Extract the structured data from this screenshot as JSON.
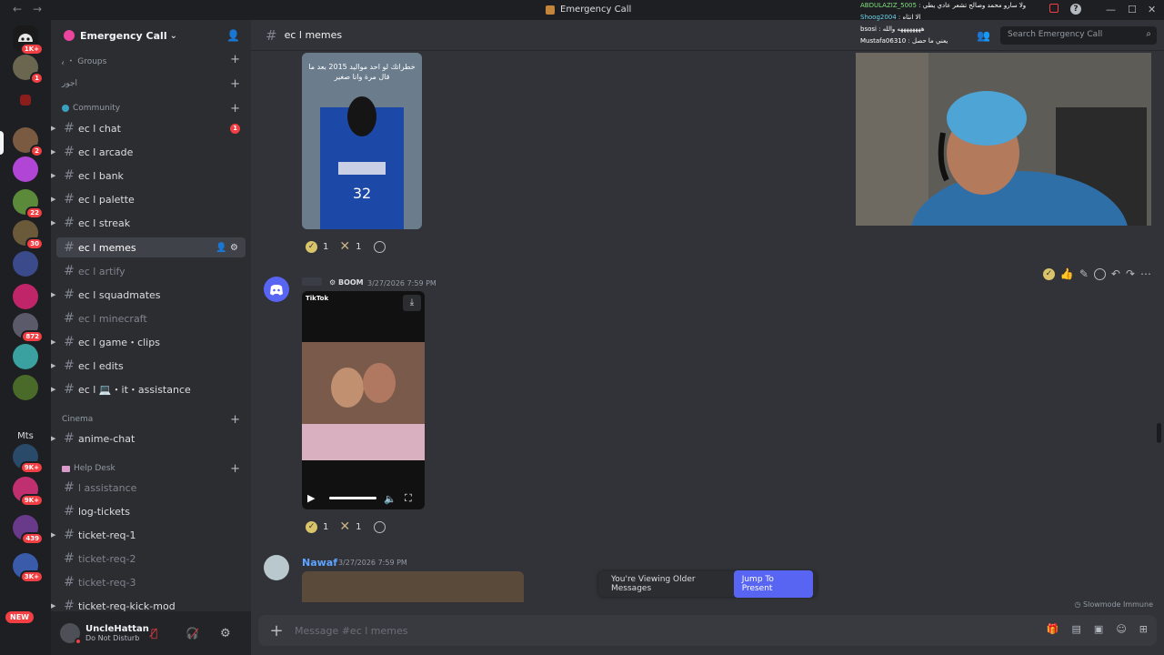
{
  "window": {
    "title": "Emergency Call",
    "back": "←",
    "forward": "→"
  },
  "guilds": {
    "badges": [
      "1K+",
      "1",
      "2",
      "22",
      "30",
      "872",
      "9K+",
      "9K+",
      "439",
      "3K+",
      "1K+"
    ],
    "mts": "Mts",
    "new": "NEW"
  },
  "server": {
    "name": "Emergency Call",
    "chevron": "⌄"
  },
  "categories": {
    "groups": "ﯾ ・ Groups",
    "ajoor": "اجور",
    "community": "Community",
    "cinema": "Cinema",
    "helpdesk": "Help Desk"
  },
  "channels": [
    {
      "name": "ec ⅼ chat",
      "badge": "1"
    },
    {
      "name": "ec ⅼ arcade"
    },
    {
      "name": "ec ⅼ bank"
    },
    {
      "name": "ec ⅼ palette"
    },
    {
      "name": "ec ⅼ streak"
    },
    {
      "name": "ec ⅼ memes"
    },
    {
      "name": "ec ⅼ artify"
    },
    {
      "name": "ec ⅼ squadmates"
    },
    {
      "name": "ec ⅼ minecraft"
    },
    {
      "name": "ec ⅼ game・clips"
    },
    {
      "name": "ec ⅼ edits"
    },
    {
      "name": "ec ⅼ 💻・it・assistance"
    },
    {
      "name": "anime-chat"
    },
    {
      "name": "ⅼ assistance"
    },
    {
      "name": "log-tickets"
    },
    {
      "name": "ticket-req-1"
    },
    {
      "name": "ticket-req-2"
    },
    {
      "name": "ticket-req-3"
    },
    {
      "name": "ticket-req-kick-mod"
    }
  ],
  "user": {
    "name": "UncleHattan",
    "status": "Do Not Disturb"
  },
  "channel_header": {
    "name": "ec ⅼ memes",
    "search_placeholder": "Search Emergency Call"
  },
  "messages": [
    {
      "image_caption": "خطراتك لو احد مواليد 2015 بعد ما قال مرة وانا صغير",
      "reactions": {
        "check": "1",
        "x": "1"
      }
    },
    {
      "author": "",
      "tag": "BOOM",
      "timestamp": "3/27/2026 7:59 PM",
      "video_source": "TikTok",
      "reactions": {
        "check": "1",
        "x": "1"
      }
    },
    {
      "author": "Nawaf",
      "timestamp": "3/27/2026 7:59 PM"
    }
  ],
  "jump_bar": {
    "label": "You're Viewing Older Messages",
    "button": "Jump To Present"
  },
  "slowmode": "Slowmode Immune",
  "composer": {
    "placeholder": "Message #ec ⅼ memes"
  },
  "stream_chat": [
    {
      "user": "ABDULAZIZ_5005",
      "text": "ولا سارو محمد وصالح تشعر عادي يطي",
      "color": "#7ee07e"
    },
    {
      "user": "Shoog2004",
      "text": "الا انثاه",
      "color": "#6fd6f0"
    },
    {
      "user": "bsosi",
      "text": "ههههههههه والله",
      "color": "#ffffff"
    },
    {
      "user": "Mustafa06310",
      "text": "يعني ما حصل",
      "color": "#ffffff"
    }
  ],
  "colors": {
    "accent": "#5865f2",
    "badge": "#f23f43",
    "nawaf": "#5ea4ff"
  }
}
